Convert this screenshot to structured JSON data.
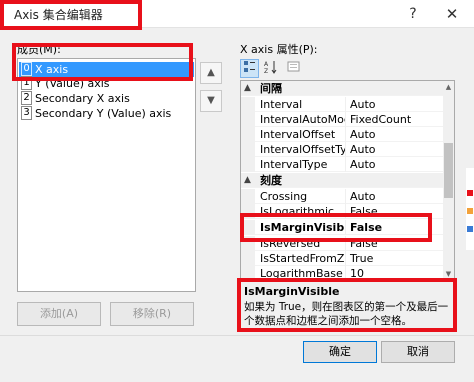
{
  "window": {
    "title": "Axis 集合编辑器",
    "help_label": "?",
    "close_label": "✕"
  },
  "members": {
    "label": "成员(M):",
    "items": [
      {
        "index": "0",
        "name": "X axis"
      },
      {
        "index": "1",
        "name": "Y (Value) axis"
      },
      {
        "index": "2",
        "name": "Secondary X axis"
      },
      {
        "index": "3",
        "name": "Secondary Y (Value) axis"
      }
    ],
    "add_label": "添加(A)",
    "remove_label": "移除(R)",
    "up_icon": "arrow-up-icon",
    "down_icon": "arrow-down-icon"
  },
  "properties": {
    "label": "X axis 属性(P):",
    "toolbar": [
      "categorized-icon",
      "alphabetical-icon",
      "property-pages-icon"
    ],
    "rows": [
      {
        "kind": "cat",
        "name": "间隔"
      },
      {
        "kind": "prop",
        "name": "Interval",
        "value": "Auto"
      },
      {
        "kind": "prop",
        "name": "IntervalAutoMod",
        "value": "FixedCount"
      },
      {
        "kind": "prop",
        "name": "IntervalOffset",
        "value": "Auto"
      },
      {
        "kind": "prop",
        "name": "IntervalOffsetTyp",
        "value": "Auto"
      },
      {
        "kind": "prop",
        "name": "IntervalType",
        "value": "Auto"
      },
      {
        "kind": "cat",
        "name": "刻度"
      },
      {
        "kind": "prop",
        "name": "Crossing",
        "value": "Auto"
      },
      {
        "kind": "prop",
        "name": "IsLogarithmic",
        "value": "False"
      },
      {
        "kind": "prop",
        "name": "IsMarginVisible",
        "value": "False",
        "selected": true
      },
      {
        "kind": "prop",
        "name": "IsReversed",
        "value": "False"
      },
      {
        "kind": "prop",
        "name": "IsStartedFromZer",
        "value": "True"
      },
      {
        "kind": "prop",
        "name": "LogarithmBase",
        "value": "10"
      }
    ]
  },
  "description": {
    "title": "IsMarginVisible",
    "text": "如果为 True，则在图表区的第一个及最后一个数据点和边框之间添加一个空格。"
  },
  "footer": {
    "ok_label": "确定",
    "cancel_label": "取消"
  },
  "colors": {
    "highlight": "#e8101a",
    "selection": "#3399ff"
  }
}
